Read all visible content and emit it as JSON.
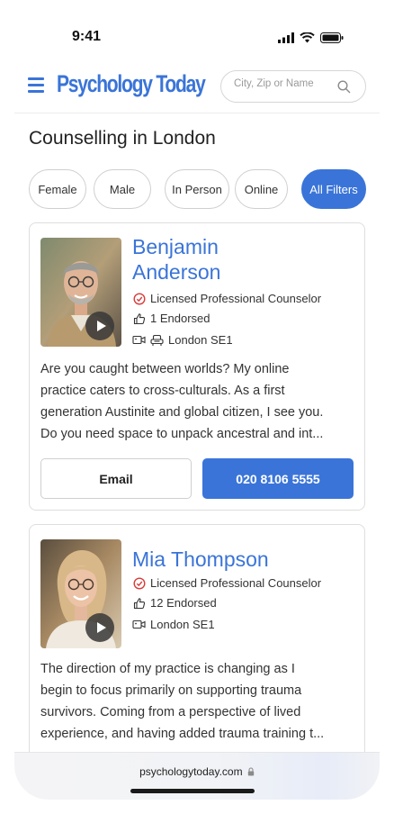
{
  "status_bar": {
    "time": "9:41"
  },
  "header": {
    "logo_text": "Psychology Today",
    "search_placeholder": "City, Zip or Name"
  },
  "page": {
    "title": "Counselling in London"
  },
  "filters": [
    {
      "label": "Female",
      "active": false
    },
    {
      "label": "Male",
      "active": false
    },
    {
      "label": "In Person",
      "active": false
    },
    {
      "label": "Online",
      "active": false
    },
    {
      "label": "All Filters",
      "active": true
    }
  ],
  "profiles": [
    {
      "name_line1": "Benjamin",
      "name_line2": "Anderson",
      "credential": "Licensed Professional Counselor",
      "endorsed": "1 Endorsed",
      "location": "London SE1",
      "bio_lines": [
        "Are you caught between worlds? My online",
        "practice caters to cross-culturals. As a first",
        "generation Austinite and global citizen, I see you.",
        "Do you need space to unpack ancestral and int..."
      ],
      "email_label": "Email",
      "phone": "020 8106 5555"
    },
    {
      "name_line1": "Mia Thompson",
      "credential": "Licensed Professional Counselor",
      "endorsed": "12 Endorsed",
      "location": "London SE1",
      "bio_lines": [
        "The direction of my practice is changing as I",
        "begin to focus primarily on supporting trauma",
        "survivors. Coming from a perspective of lived",
        "experience, and having added trauma training t..."
      ]
    }
  ],
  "browser": {
    "url": "psychologytoday.com"
  },
  "colors": {
    "accent": "#3a74d8",
    "credential_check": "#d93a3a"
  },
  "icons": [
    "hamburger-menu-icon",
    "search-icon",
    "check-badge-icon",
    "thumbs-up-icon",
    "video-icon",
    "couch-icon",
    "lock-icon",
    "play-icon"
  ]
}
